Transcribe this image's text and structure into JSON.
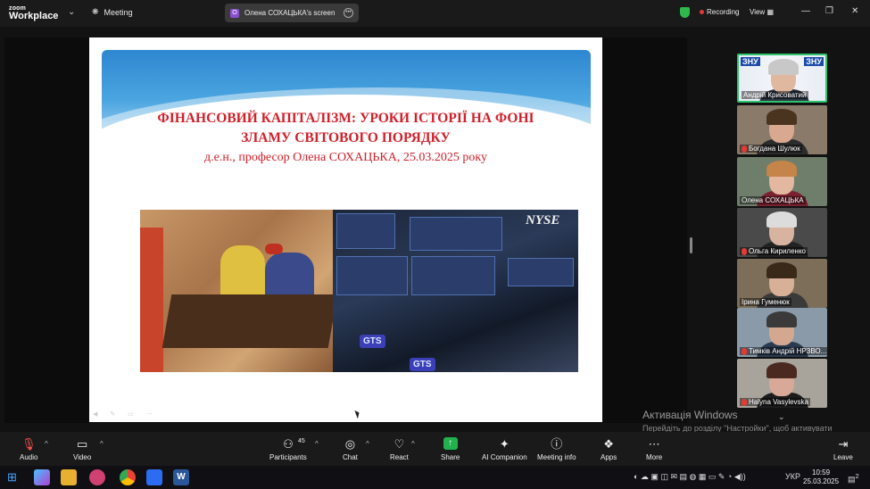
{
  "app": {
    "logo_top": "zoom",
    "logo_bottom": "Workplace",
    "meeting_label": "Meeting"
  },
  "share_pill": {
    "initial": "О",
    "label": "Олена СОХАЦЬКА's screen"
  },
  "status": {
    "recording_label": "Recording",
    "view_label": "View"
  },
  "slide": {
    "title_line1": "ФІНАНСОВИЙ КАПІТАЛІЗМ: УРОКИ ІСТОРІЇ НА ФОНІ",
    "title_line2": "ЗЛАМУ СВІТОВОГО ПОРЯДКУ",
    "subtitle": "д.е.н., професор Олена СОХАЦЬКА, 25.03.2025 року",
    "right_image_logo": "NYSE",
    "right_image_badge": "GTS"
  },
  "participants": [
    {
      "name": "Андрій Крисоватий",
      "muted": false,
      "active": true,
      "tile_logo": "ЗНУ"
    },
    {
      "name": "Богдана Шулюк",
      "muted": true
    },
    {
      "name": "Олена СОХАЦЬКА",
      "muted": false
    },
    {
      "name": "Ольга Кириленко",
      "muted": true
    },
    {
      "name": "Ірина Гуменюк",
      "muted": false
    },
    {
      "name": "Тимків Андрій НРЗВО...",
      "muted": true
    },
    {
      "name": "Halyna Vasylevska",
      "muted": true
    }
  ],
  "activation": {
    "title": "Активація Windows",
    "text": "Перейдіть до розділу \"Настройки\", щоб активувати Windows."
  },
  "toolbar": {
    "audio": "Audio",
    "video": "Video",
    "participants": "Participants",
    "participants_count": "45",
    "chat": "Chat",
    "react": "React",
    "share": "Share",
    "ai_companion": "AI Companion",
    "meeting_info": "Meeting info",
    "apps": "Apps",
    "more": "More",
    "leave": "Leave"
  },
  "taskbar": {
    "lang": "УКР",
    "time": "10:59",
    "date": "25.03.2025",
    "notif_count": "2"
  },
  "colors": {
    "accent_green": "#2fc46e",
    "record_red": "#e53935",
    "title_red": "#d0202a"
  }
}
